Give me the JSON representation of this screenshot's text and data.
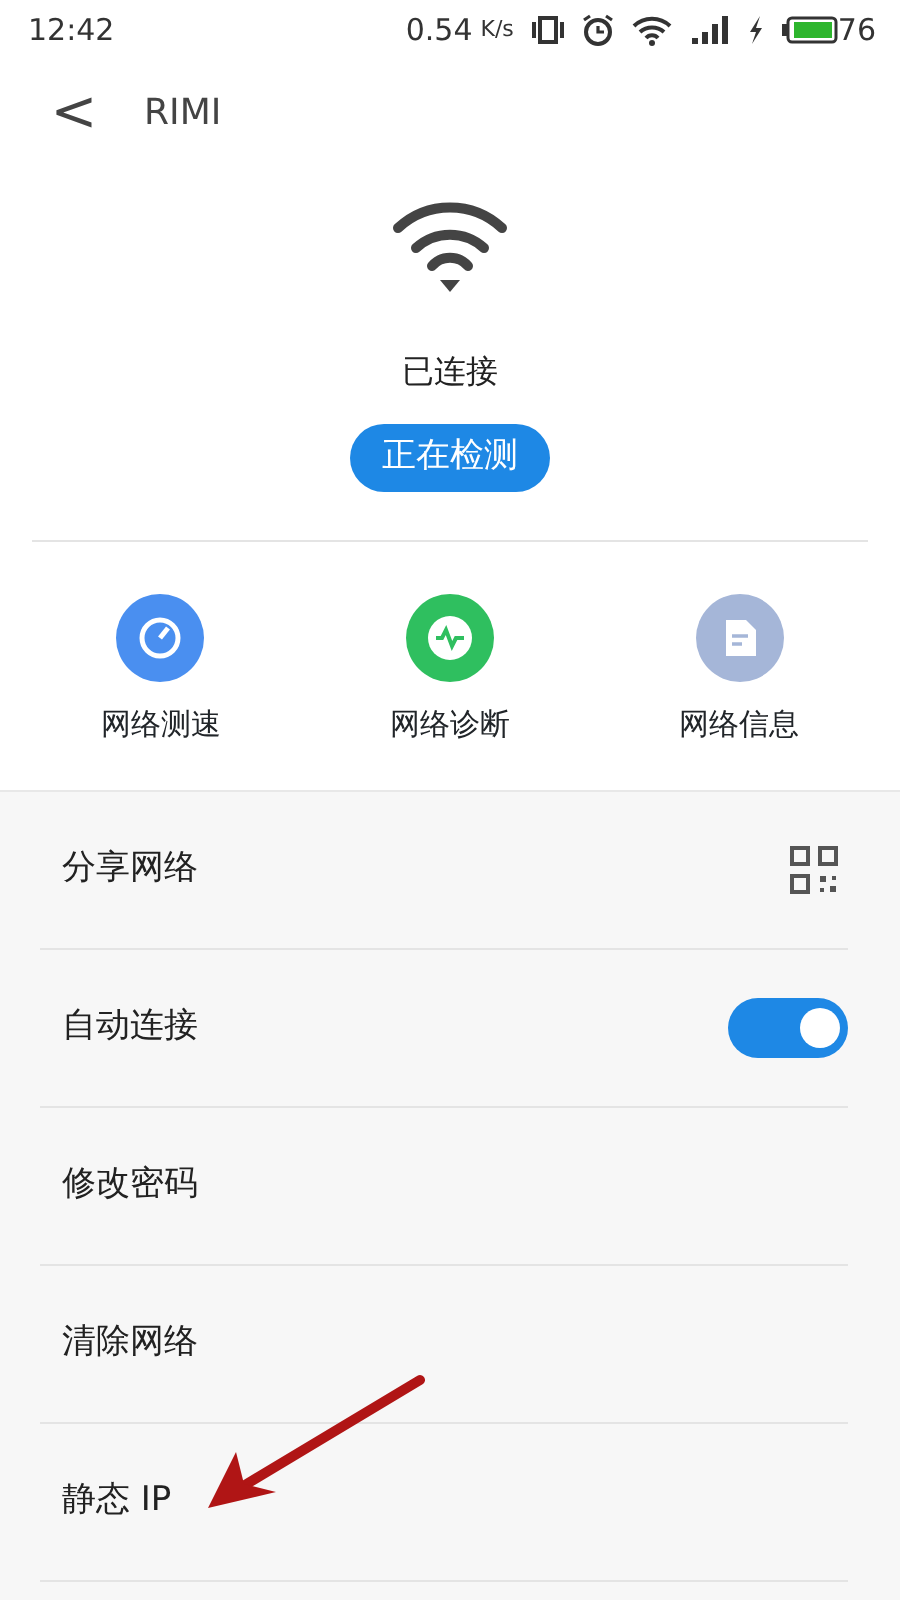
{
  "status_bar": {
    "time": "12:42",
    "speed": "0.54",
    "speed_unit": "K/s",
    "battery": "76"
  },
  "header": {
    "back": "<",
    "title": "RIMI"
  },
  "connection": {
    "status": "已连接",
    "button": "正在检测"
  },
  "actions": [
    {
      "kind": "speed",
      "label": "网络测速",
      "color": "#4a8ff0"
    },
    {
      "kind": "pulse",
      "label": "网络诊断",
      "color": "#2fbf5f"
    },
    {
      "kind": "doc",
      "label": "网络信息",
      "color": "#a5b6d8"
    }
  ],
  "settings": [
    {
      "kind": "qr",
      "label": "分享网络"
    },
    {
      "kind": "toggle",
      "label": "自动连接",
      "on": true
    },
    {
      "kind": "plain",
      "label": "修改密码"
    },
    {
      "kind": "plain",
      "label": "清除网络"
    },
    {
      "kind": "plain",
      "label": "静态 IP"
    }
  ]
}
